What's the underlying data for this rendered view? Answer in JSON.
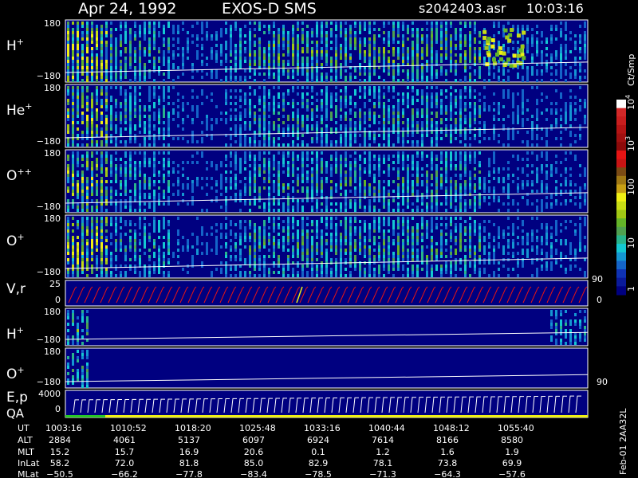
{
  "header": {
    "date": "Apr 24, 1992",
    "instrument": "EXOS-D SMS",
    "file": "s2042403.asr",
    "time": "10:03:16"
  },
  "colorbar": {
    "unit": "Ct/Smp",
    "ticks": [
      "1",
      "10",
      "100",
      "10",
      "10"
    ],
    "exponents": [
      "",
      "",
      "",
      "3",
      "4"
    ],
    "colors": [
      "#000080",
      "#0a1a9a",
      "#0f32b4",
      "#1464c8",
      "#1496d2",
      "#14c8d2",
      "#28b48c",
      "#50a050",
      "#64b428",
      "#a0c814",
      "#c8dc14",
      "#f0f014",
      "#c8a014",
      "#a07814",
      "#7a4a14",
      "#c81414",
      "#e61414",
      "#8c0a0a",
      "#a01010",
      "#b41414",
      "#c81e1e",
      "#d22828",
      "#ffffff"
    ]
  },
  "panels": [
    {
      "label": "H",
      "superscript": "+",
      "ymax": "180",
      "ymin": "−180"
    },
    {
      "label": "He",
      "superscript": "+",
      "ymax": "180",
      "ymin": "−180"
    },
    {
      "label": "O",
      "superscript": "++",
      "ymax": "180",
      "ymin": "−180"
    },
    {
      "label": "O",
      "superscript": "+",
      "ymax": "180",
      "ymin": "−180"
    },
    {
      "label": "V,r",
      "superscript": "",
      "ymax": "25",
      "ymin": "0",
      "right_top": "90",
      "right_bottom": "0"
    },
    {
      "label": "H",
      "superscript": "+",
      "ymax": "180",
      "ymin": "−180"
    },
    {
      "label": "O",
      "superscript": "+",
      "ymax": "180",
      "ymin": "−180",
      "right_bottom": "90"
    },
    {
      "label": "E,p",
      "label2": "QA",
      "superscript": "",
      "ymax": "4000",
      "ymin": "0"
    }
  ],
  "footer": {
    "row_labels": [
      "UT",
      "ALT",
      "MLT",
      "InLat",
      "MLat"
    ],
    "columns": [
      [
        "1003:16",
        "2884",
        "15.2",
        "58.2",
        "−50.5"
      ],
      [
        "1010:52",
        "4061",
        "15.7",
        "72.0",
        "−66.2"
      ],
      [
        "1018:20",
        "5137",
        "16.9",
        "81.8",
        "−77.8"
      ],
      [
        "1025:48",
        "6097",
        "20.6",
        "85.0",
        "−83.4"
      ],
      [
        "1033:16",
        "6924",
        "0.1",
        "82.9",
        "−78.5"
      ],
      [
        "1040:44",
        "7614",
        "1.2",
        "78.1",
        "−71.3"
      ],
      [
        "1048:12",
        "8166",
        "1.6",
        "73.8",
        "−64.3"
      ],
      [
        "1055:40",
        "8580",
        "1.9",
        "69.9",
        "−57.6"
      ]
    ],
    "vertical_note": "Feb-01 2AA32L"
  },
  "chart_data": {
    "type": "heatmap",
    "title": "Apr 24, 1992    EXOS-D SMS",
    "xlabel": "UT",
    "x_ticks": [
      "1003:16",
      "1010:52",
      "1018:20",
      "1025:48",
      "1033:16",
      "1040:44",
      "1048:12",
      "1055:40"
    ],
    "color_scale": "log",
    "color_range": [
      1,
      10000
    ],
    "series": [
      {
        "name": "H+",
        "ylim": [
          -180,
          180
        ]
      },
      {
        "name": "He+",
        "ylim": [
          -180,
          180
        ]
      },
      {
        "name": "O++",
        "ylim": [
          -180,
          180
        ]
      },
      {
        "name": "O+",
        "ylim": [
          -180,
          180
        ]
      },
      {
        "name": "V,r",
        "ylim": [
          0,
          25
        ]
      },
      {
        "name": "H+",
        "ylim": [
          -180,
          180
        ]
      },
      {
        "name": "O+",
        "ylim": [
          -180,
          180
        ]
      },
      {
        "name": "E,p",
        "ylim": [
          0,
          4000
        ]
      }
    ]
  }
}
